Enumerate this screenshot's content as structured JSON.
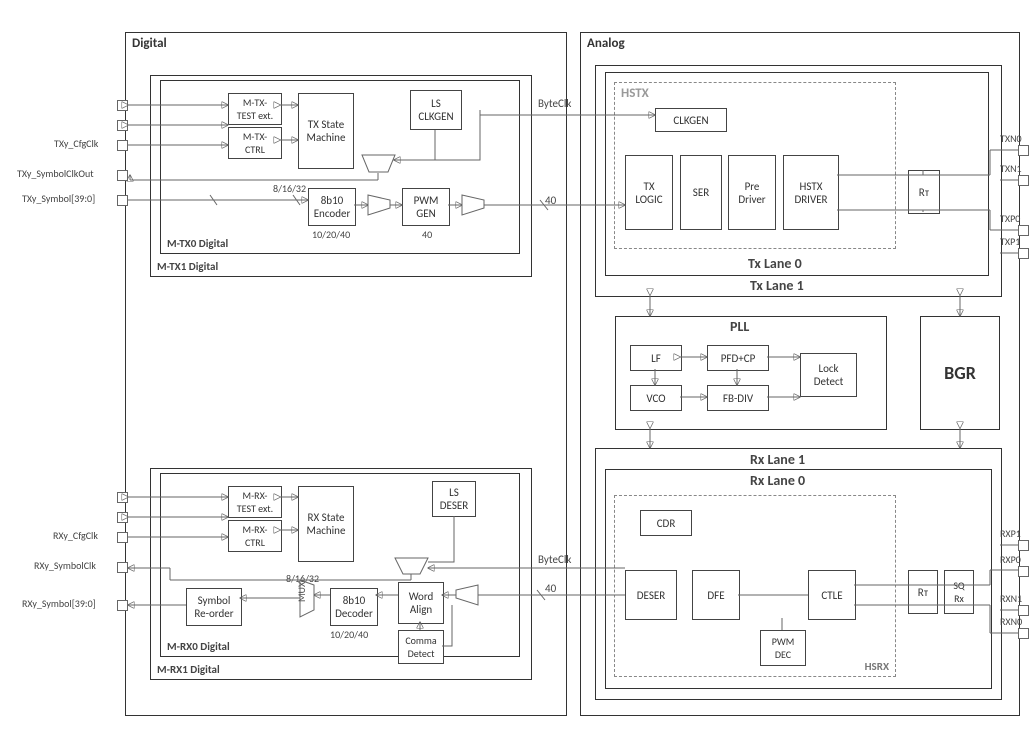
{
  "sections": {
    "digital": "Digital",
    "analog": "Analog"
  },
  "tx": {
    "frame0": "M-TX0 Digital",
    "frame1": "M-TX1 Digital",
    "blocks": {
      "test": "M-TX-\nTEST ext.",
      "ctrl": "M-TX-\nCTRL",
      "sm": "TX State\nMachine",
      "enc": "8b10\nEncoder",
      "ls": "LS\nCLKGEN",
      "pwm": "PWM\nGEN"
    },
    "labels": {
      "byteclk": "ByteClk",
      "b40": "40",
      "b40_2": "40",
      "b81632": "8/16/32",
      "b102040": "10/20/40"
    }
  },
  "rx": {
    "frame0": "M-RX0 Digital",
    "frame1": "M-RX1 Digital",
    "blocks": {
      "test": "M-RX-\nTEST ext.",
      "ctrl": "M-RX-\nCTRL",
      "sm": "RX State\nMachine",
      "dec": "8b10\nDecoder",
      "ls": "LS\nDESER",
      "reorder": "Symbol\nRe-order",
      "align": "Word\nAlign",
      "comma": "Comma\nDetect",
      "mux": "MUX"
    },
    "labels": {
      "byteclk": "ByteClk",
      "b40": "40",
      "b81632": "8/16/32",
      "b102040": "10/20/40"
    }
  },
  "hstx": {
    "title": "HSTX",
    "clkgen": "CLKGEN",
    "blocks": {
      "logic": "TX\nLOGIC",
      "ser": "SER",
      "pre": "Pre\nDriver",
      "drv": "HSTX\nDRIVER",
      "rt": "Rᴛ"
    },
    "lane0": "Tx Lane 0",
    "lane1": "Tx Lane 1"
  },
  "pll": {
    "title": "PLL",
    "lf": "LF",
    "pfdcp": "PFD+CP",
    "vco": "VCO",
    "fbdiv": "FB-DIV",
    "lock": "Lock\nDetect"
  },
  "bgr": "BGR",
  "hsrx": {
    "title": "HSRX",
    "lane1": "Rx Lane 1",
    "lane0": "Rx Lane 0",
    "blocks": {
      "cdr": "CDR",
      "deser": "DESER",
      "dfe": "DFE",
      "ctle": "CTLE",
      "pwmdec": "PWM\nDEC",
      "rt": "Rᴛ",
      "sqrc": "SQ\nRx"
    }
  },
  "ports_left": {
    "txy_cfgclk": "TXy_CfgClk",
    "txy_symclkout": "TXy_SymbolClkOut",
    "txy_symbol": "TXy_Symbol[39:0]",
    "rxy_cfgclk": "RXy_CfgClk",
    "rxy_symclk": "RXy_SymbolClk",
    "rxy_symbol": "RXy_Symbol[39:0]"
  },
  "ports_right": {
    "txn0": "TXN0",
    "txn1": "TXN1",
    "txp0": "TXP0",
    "txp1": "TXP1",
    "rxp1": "RXP1",
    "rxp0": "RXP0",
    "rxn1": "RXN1",
    "rxn0": "RXN0"
  }
}
